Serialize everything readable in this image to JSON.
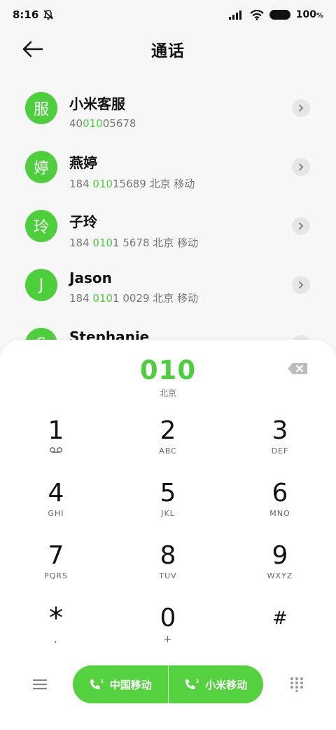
{
  "status_bar": {
    "time": "8:16",
    "battery_text": "100"
  },
  "header": {
    "title": "通话"
  },
  "contacts": [
    {
      "avatar": "服",
      "name": "小米客服",
      "num_pre": "40",
      "num_hl": "010",
      "num_post": "05678"
    },
    {
      "avatar": "婷",
      "name": "燕婷",
      "num_pre": "184 ",
      "num_hl": "010",
      "num_post": "15689  北京 移动"
    },
    {
      "avatar": "玲",
      "name": "子玲",
      "num_pre": "184 ",
      "num_hl": "010",
      "num_post": "1 5678  北京 移动"
    },
    {
      "avatar": "J",
      "name": "Jason",
      "num_pre": "184 ",
      "num_hl": "010",
      "num_post": "1 0029  北京 移动"
    },
    {
      "avatar": "S",
      "name": "Stephanie",
      "num_pre": "",
      "num_hl": "",
      "num_post": ""
    }
  ],
  "dialer": {
    "number": "010",
    "region": "北京",
    "keys": [
      {
        "digit": "1",
        "sub": ""
      },
      {
        "digit": "2",
        "sub": "ABC"
      },
      {
        "digit": "3",
        "sub": "DEF"
      },
      {
        "digit": "4",
        "sub": "GHI"
      },
      {
        "digit": "5",
        "sub": "JKL"
      },
      {
        "digit": "6",
        "sub": "MNO"
      },
      {
        "digit": "7",
        "sub": "PQRS"
      },
      {
        "digit": "8",
        "sub": "TUV"
      },
      {
        "digit": "9",
        "sub": "WXYZ"
      },
      {
        "digit": "*",
        "sub": ","
      },
      {
        "digit": "0",
        "sub": "+"
      },
      {
        "digit": "#",
        "sub": ""
      }
    ]
  },
  "call_buttons": [
    {
      "label": "中国移动",
      "sim": "1"
    },
    {
      "label": "小米移动",
      "sim": "2"
    }
  ],
  "colors": {
    "accent": "#4ccf3b",
    "call_button": "#54d13f"
  },
  "icons": {
    "back": "arrow-left-icon",
    "mute": "bell-off-icon",
    "signal": "signal-icon",
    "wifi": "wifi-icon",
    "chevron": "chevron-right-icon",
    "delete": "backspace-icon",
    "voicemail": "voicemail-icon",
    "menu": "menu-icon",
    "keypad": "keypad-icon",
    "phone": "phone-icon"
  }
}
